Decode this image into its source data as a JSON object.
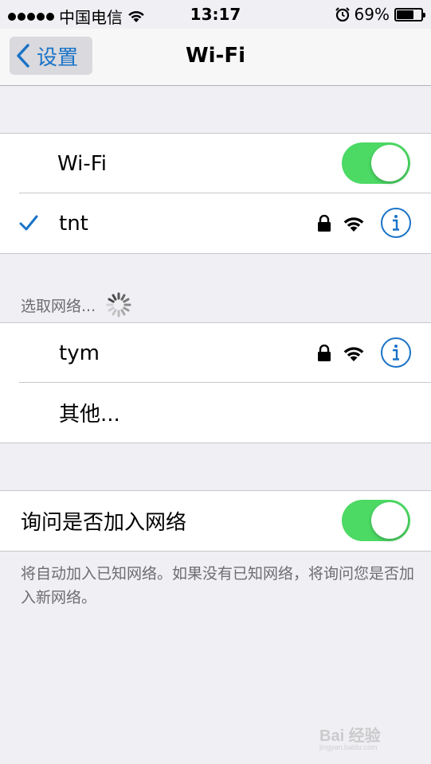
{
  "status_bar": {
    "carrier": "中国电信",
    "time": "13:17",
    "battery_percent": "69%",
    "battery_level": 0.69,
    "icons": [
      "signal-dots-icon",
      "wifi-signal-icon",
      "alarm-icon",
      "battery-icon"
    ]
  },
  "nav": {
    "back_label": "设置",
    "title": "Wi-Fi"
  },
  "wifi_toggle": {
    "label": "Wi-Fi",
    "on": true
  },
  "connected_network": {
    "name": "tnt",
    "icons": [
      "checkmark-icon",
      "lock-icon",
      "wifi-signal-icon",
      "info-icon"
    ]
  },
  "choose_network": {
    "header": "选取网络...",
    "networks": [
      {
        "name": "tym"
      }
    ],
    "other_label": "其他..."
  },
  "ask_to_join": {
    "label": "询问是否加入网络",
    "on": true,
    "footer": "将自动加入已知网络。如果没有已知网络，将询问您是否加入新网络。"
  },
  "colors": {
    "accent": "#1a73c7",
    "toggle_on": "#4cd964",
    "background": "#efeff4"
  },
  "watermark": {
    "brand": "Bai 经验",
    "sub": "jingyan.baidu.com"
  }
}
